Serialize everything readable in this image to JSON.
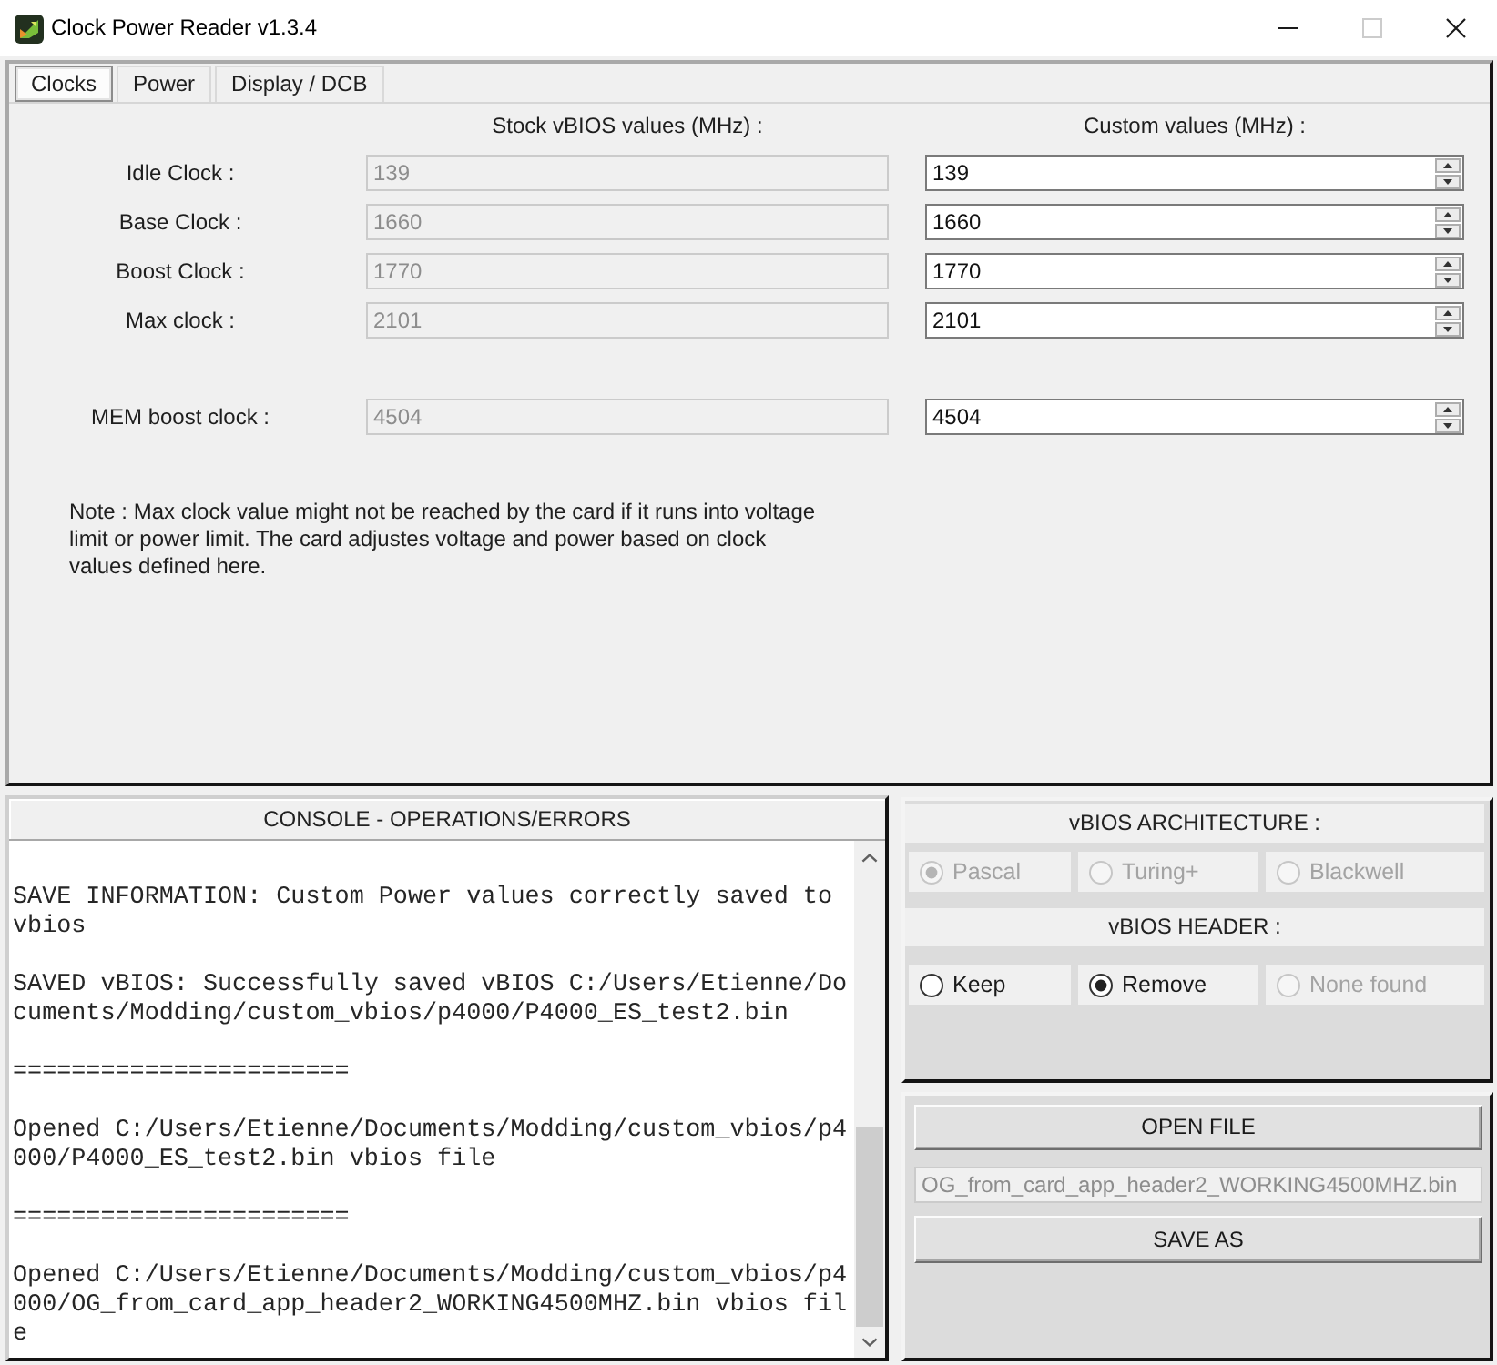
{
  "window": {
    "title": "Clock Power Reader v1.3.4",
    "controls": [
      {
        "kind": "minimize",
        "disabled": false
      },
      {
        "kind": "maximize",
        "disabled": true
      },
      {
        "kind": "close",
        "disabled": false
      }
    ]
  },
  "tabs": [
    {
      "label": "Clocks",
      "selected": true
    },
    {
      "label": "Power",
      "selected": false
    },
    {
      "label": "Display / DCB",
      "selected": false
    }
  ],
  "clocks": {
    "stock_header": "Stock vBIOS values (MHz) :",
    "custom_header": "Custom values (MHz) :",
    "core_rows": [
      {
        "label": "Idle Clock :",
        "stock": {
          "value": "139",
          "disabled": true
        },
        "custom": {
          "value": "139",
          "disabled": false
        }
      },
      {
        "label": "Base Clock :",
        "stock": {
          "value": "1660",
          "disabled": true
        },
        "custom": {
          "value": "1660",
          "disabled": false
        }
      },
      {
        "label": "Boost Clock :",
        "stock": {
          "value": "1770",
          "disabled": true
        },
        "custom": {
          "value": "1770",
          "disabled": false
        }
      },
      {
        "label": "Max clock :",
        "stock": {
          "value": "2101",
          "disabled": true
        },
        "custom": {
          "value": "2101",
          "disabled": false
        }
      }
    ],
    "memory_rows": [
      {
        "label": "MEM boost clock :",
        "stock": {
          "value": "4504",
          "disabled": true
        },
        "custom": {
          "value": "4504",
          "disabled": false
        }
      }
    ],
    "note": "Note : Max clock value might not be reached by the card if it runs into voltage limit or power limit. The card adjustes voltage and power based on clock values defined here."
  },
  "console": {
    "title": "CONSOLE - OPERATIONS/ERRORS",
    "messages": [
      "SAVE INFORMATION: Custom Power values correctly saved to vbios",
      "SAVED vBIOS: Successfully saved vBIOS C:/Users/Etienne/Documents/Modding/custom_vbios/p4000/P4000_ES_test2.bin",
      "=======================",
      "Opened C:/Users/Etienne/Documents/Modding/custom_vbios/p4000/P4000_ES_test2.bin vbios file",
      "=======================",
      "Opened C:/Users/Etienne/Documents/Modding/custom_vbios/p4000/OG_from_card_app_header2_WORKING4500MHZ.bin vbios file"
    ]
  },
  "architecture": {
    "title": "vBIOS ARCHITECTURE :",
    "options": [
      {
        "label": "Pascal",
        "selected": true,
        "disabled": true
      },
      {
        "label": "Turing+",
        "selected": false,
        "disabled": true
      },
      {
        "label": "Blackwell",
        "selected": false,
        "disabled": true
      }
    ]
  },
  "header": {
    "title": "vBIOS HEADER :",
    "options": [
      {
        "label": "Keep",
        "selected": false,
        "disabled": false
      },
      {
        "label": "Remove",
        "selected": true,
        "disabled": false
      },
      {
        "label": "None found",
        "selected": false,
        "disabled": true
      }
    ]
  },
  "file": {
    "open_button": "OPEN FILE",
    "file_name": {
      "value": "OG_from_card_app_header2_WORKING4500MHZ.bin",
      "disabled": true
    },
    "save_button": "SAVE AS"
  }
}
